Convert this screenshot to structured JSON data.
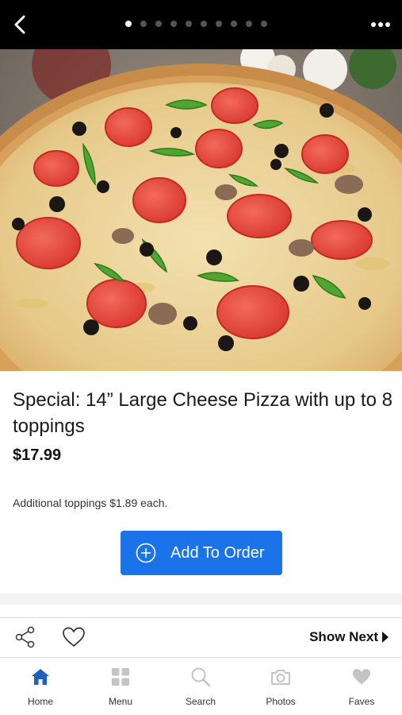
{
  "header": {
    "carousel_total": 10,
    "carousel_active_index": 0
  },
  "item": {
    "title": "Special: 14” Large Cheese Pizza with up to 8 toppings",
    "price": "$17.99",
    "note": "Additional toppings $1.89 each.",
    "add_button_label": "Add To Order"
  },
  "actions": {
    "show_next_label": "Show Next"
  },
  "tabs": [
    {
      "label": "Home",
      "icon": "home-icon",
      "active": true
    },
    {
      "label": "Menu",
      "icon": "grid-icon",
      "active": false
    },
    {
      "label": "Search",
      "icon": "search-icon",
      "active": false
    },
    {
      "label": "Photos",
      "icon": "camera-icon",
      "active": false
    },
    {
      "label": "Faves",
      "icon": "heart-icon",
      "active": false
    }
  ],
  "colors": {
    "accent": "#1a73e8",
    "active_tab": "#1f5fbf",
    "inactive_tab": "#c4c4c4"
  }
}
